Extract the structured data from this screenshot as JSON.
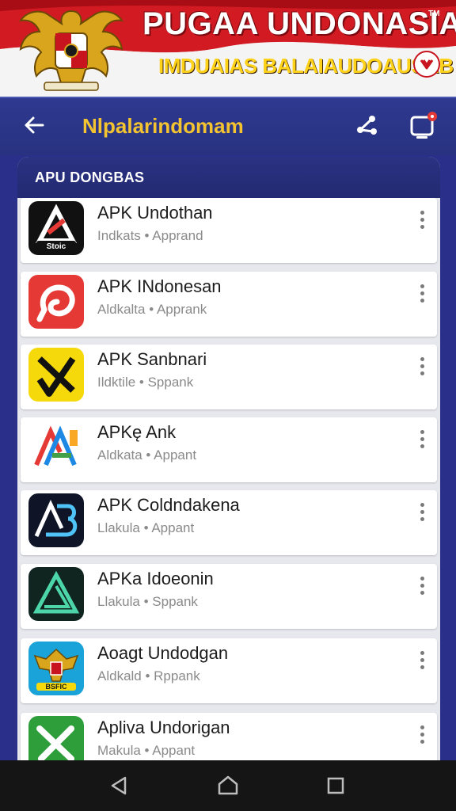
{
  "banner": {
    "title": "PUGAA UNDONASIA",
    "trademark": "TM",
    "subtitle": "IMDUAIAS BALAIAUDOAUSAB",
    "colors": {
      "red": "#c8141e",
      "gold": "#ffd21a"
    }
  },
  "toolbar": {
    "title": "Nlpalarindomam",
    "back_icon": "arrow-left-icon",
    "share_icon": "share-icon",
    "device_icon": "device-notification-icon",
    "title_color": "#f4c430"
  },
  "section": {
    "header": "APU DONGBAS"
  },
  "apps": [
    {
      "name": "APK Undothan",
      "meta": "Indkats • Apprand",
      "icon": "a-triangle-black-icon"
    },
    {
      "name": "APK INdonesan",
      "meta": "Aldkalta • Apprank",
      "icon": "red-swirl-icon"
    },
    {
      "name": "APK Sanbnari",
      "meta": "Ildktile • Sppank",
      "icon": "yellow-x-icon"
    },
    {
      "name": "APKę Ank",
      "meta": "Aldkata • Appant",
      "icon": "colorful-a-icon"
    },
    {
      "name": "APK Coldndakena",
      "meta": "Llakula • Appant",
      "icon": "ab-logo-icon"
    },
    {
      "name": "APKa Idoeonin",
      "meta": "Llakula • Sppank",
      "icon": "green-triangle-icon"
    },
    {
      "name": "Aoagt Undodgan",
      "meta": "Aldkald • Rppank",
      "icon": "garuda-icon"
    },
    {
      "name": "Apliva Undorigan",
      "meta": "Makula • Appant",
      "icon": "green-x-icon"
    }
  ],
  "navbar": {
    "back_icon": "nav-back-icon",
    "home_icon": "nav-home-icon",
    "recents_icon": "nav-recents-icon"
  }
}
